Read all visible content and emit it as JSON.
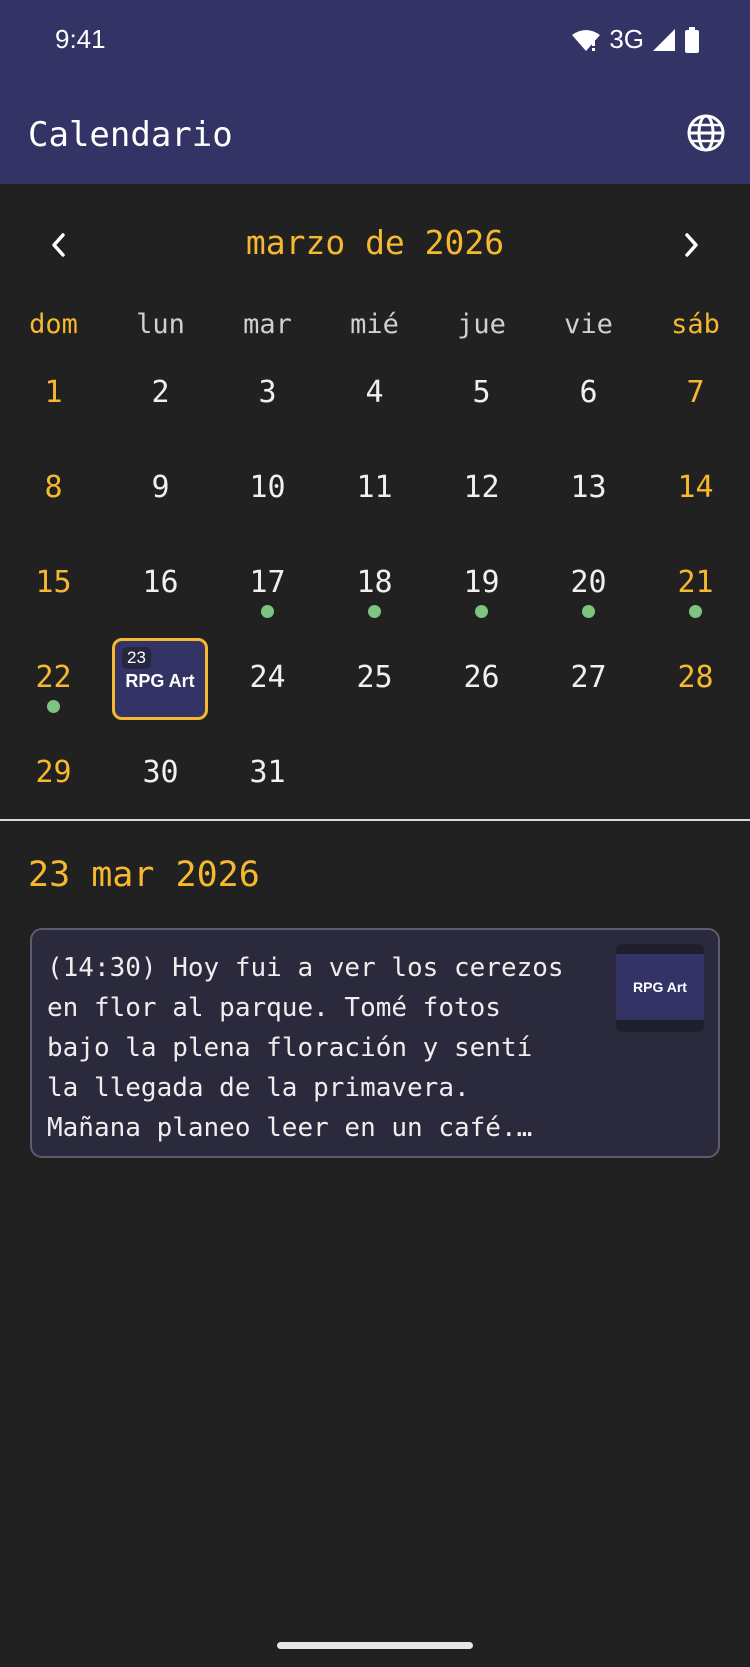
{
  "status_bar": {
    "time": "9:41",
    "network": "3G",
    "icons": [
      "wifi-icon",
      "signal-icon",
      "battery-icon"
    ]
  },
  "app_bar": {
    "title": "Calendario",
    "language_icon": "globe-icon"
  },
  "calendar": {
    "month_label": "marzo de 2026",
    "prev_icon": "chevron-left-icon",
    "next_icon": "chevron-right-icon",
    "weekdays": [
      "dom",
      "lun",
      "mar",
      "mié",
      "jue",
      "vie",
      "sáb"
    ],
    "days": [
      "1",
      "2",
      "3",
      "4",
      "5",
      "6",
      "7",
      "8",
      "9",
      "10",
      "11",
      "12",
      "13",
      "14",
      "15",
      "16",
      "17",
      "18",
      "19",
      "20",
      "21",
      "22",
      "23",
      "24",
      "25",
      "26",
      "27",
      "28",
      "29",
      "30",
      "31"
    ],
    "days_with_entries": [
      "17",
      "18",
      "19",
      "20",
      "21",
      "22"
    ],
    "selected_day": "23",
    "selected_caption": "RPG Art"
  },
  "detail": {
    "date_heading": "23 mar 2026",
    "entry_text": "(14:30) Hoy fui a ver los cerezos en flor al parque. Tomé fotos bajo la plena floración y sentí la llegada de la primavera. Mañana planeo leer en un café. ¡Nuevas aventuras espe…",
    "thumbnail_caption": "RPG Art"
  },
  "colors": {
    "app_bar": "#333366",
    "background": "#212121",
    "accent": "#f5b82e",
    "entry_dot": "#7cc47f"
  }
}
